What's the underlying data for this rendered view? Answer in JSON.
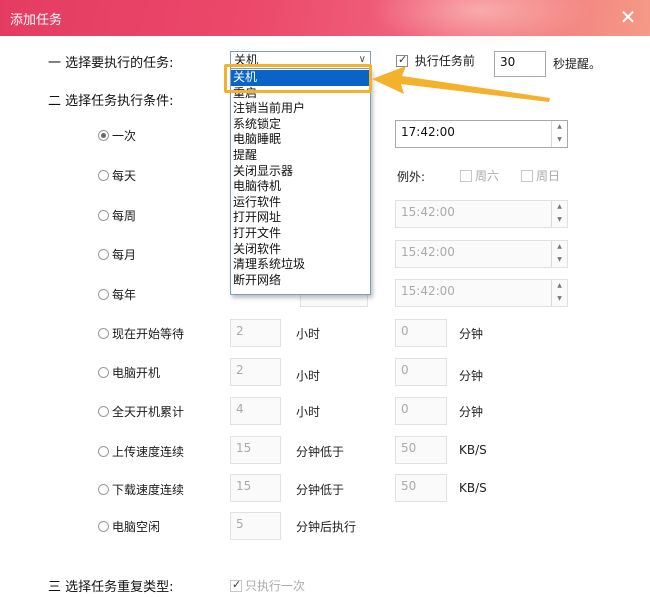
{
  "window": {
    "title": "添加任务"
  },
  "section1": {
    "label": "一  选择要执行的任务:",
    "task_select_value": "关机",
    "remind_checkbox_label": "执行任务前",
    "remind_value": "30",
    "remind_suffix": "秒提醒。",
    "task_options": [
      "关机",
      "重启",
      "注销当前用户",
      "系统锁定",
      "电脑睡眠",
      "提醒",
      "关闭显示器",
      "电脑待机",
      "运行软件",
      "打开网址",
      "打开文件",
      "关闭软件",
      "清理系统垃圾",
      "断开网络"
    ],
    "selected_option_index": 0
  },
  "section2": {
    "label": "二  选择任务执行条件:",
    "options": {
      "once": "一次",
      "daily": "每天",
      "weekly": "每周",
      "monthly": "每月",
      "yearly": "每年",
      "wait_from_now": "现在开始等待",
      "on_boot": "电脑开机",
      "uptime_total": "全天开机累计",
      "upload_speed": "上传速度连续",
      "download_speed": "下载速度连续",
      "idle": "电脑空闲"
    },
    "times": {
      "once": "17:42:00",
      "weekly": "15:42:00",
      "monthly": "15:42:00",
      "yearly": "15:42:00"
    },
    "exceptions": {
      "label": "例外:",
      "saturday": "周六",
      "sunday": "周日"
    },
    "wait_from_now": {
      "hours": "2",
      "hours_unit": "小时",
      "minutes": "0",
      "minutes_unit": "分钟"
    },
    "on_boot": {
      "hours": "2",
      "hours_unit": "小时",
      "minutes": "0",
      "minutes_unit": "分钟"
    },
    "uptime_total": {
      "hours": "4",
      "hours_unit": "小时",
      "minutes": "0",
      "minutes_unit": "分钟"
    },
    "upload_speed": {
      "minutes": "15",
      "minutes_unit": "分钟低于",
      "speed": "50",
      "speed_unit": "KB/S"
    },
    "download_speed": {
      "minutes": "15",
      "minutes_unit": "分钟低于",
      "speed": "50",
      "speed_unit": "KB/S"
    },
    "idle": {
      "minutes": "5",
      "minutes_unit": "分钟后执行"
    }
  },
  "section3": {
    "label": "三  选择任务重复类型:",
    "run_once_label": "只执行一次"
  },
  "icons": {
    "close": "close-icon",
    "dropdown": "chevron-down-icon",
    "spinner_up": "caret-up-icon",
    "spinner_down": "caret-down-icon",
    "callout_arrow": "arrow-left-icon"
  },
  "colors": {
    "titlebar_start": "#e43b62",
    "titlebar_end": "#f59a86",
    "selection": "#0a64c8",
    "callout": "#f4b12c"
  }
}
